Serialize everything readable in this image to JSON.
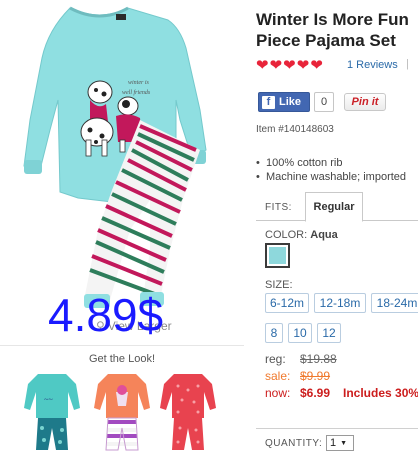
{
  "product": {
    "title_line1": "Winter Is More Fun",
    "title_line2": "Piece Pajama Set",
    "reviews": "1 Reviews",
    "review_separator": "|",
    "item_number": "Item #140148603",
    "image_graphic_text": [
      "winter is",
      "well friends"
    ],
    "price_overlay": "4.89$",
    "view_larger": "View Larger"
  },
  "rating": {
    "hearts": 5,
    "color": "#e8243a"
  },
  "social": {
    "fb_like": "Like",
    "fb_count": "0",
    "pin_it": "Pin it"
  },
  "features": [
    "100% cotton rib",
    "Machine washable; imported"
  ],
  "fits": {
    "label": "FITS:",
    "selected_tab": "Regular"
  },
  "color": {
    "label": "COLOR:",
    "value": "Aqua",
    "swatch_hex": "#8ed8dc"
  },
  "size": {
    "label": "SIZE:",
    "options": [
      "6-12m",
      "12-18m",
      "18-24m",
      "8",
      "10",
      "12"
    ]
  },
  "pricing": {
    "reg_label": "reg:",
    "reg_value": "$19.88",
    "sale_label": "sale:",
    "sale_value": "$9.99",
    "now_label": "now:",
    "now_value": "$6.99",
    "now_promo": "Includes 30%"
  },
  "quantity": {
    "label": "QUANTITY:",
    "value": "1"
  },
  "get_the_look": {
    "title": "Get the Look!"
  },
  "colors": {
    "pajama_top": "#8fdfe1",
    "stripe_pink": "#c2185b",
    "stripe_green": "#2e7d5b",
    "link_blue": "#2a6aa8",
    "price_red": "#cc1d1d",
    "sale_orange": "#f07a2e"
  }
}
